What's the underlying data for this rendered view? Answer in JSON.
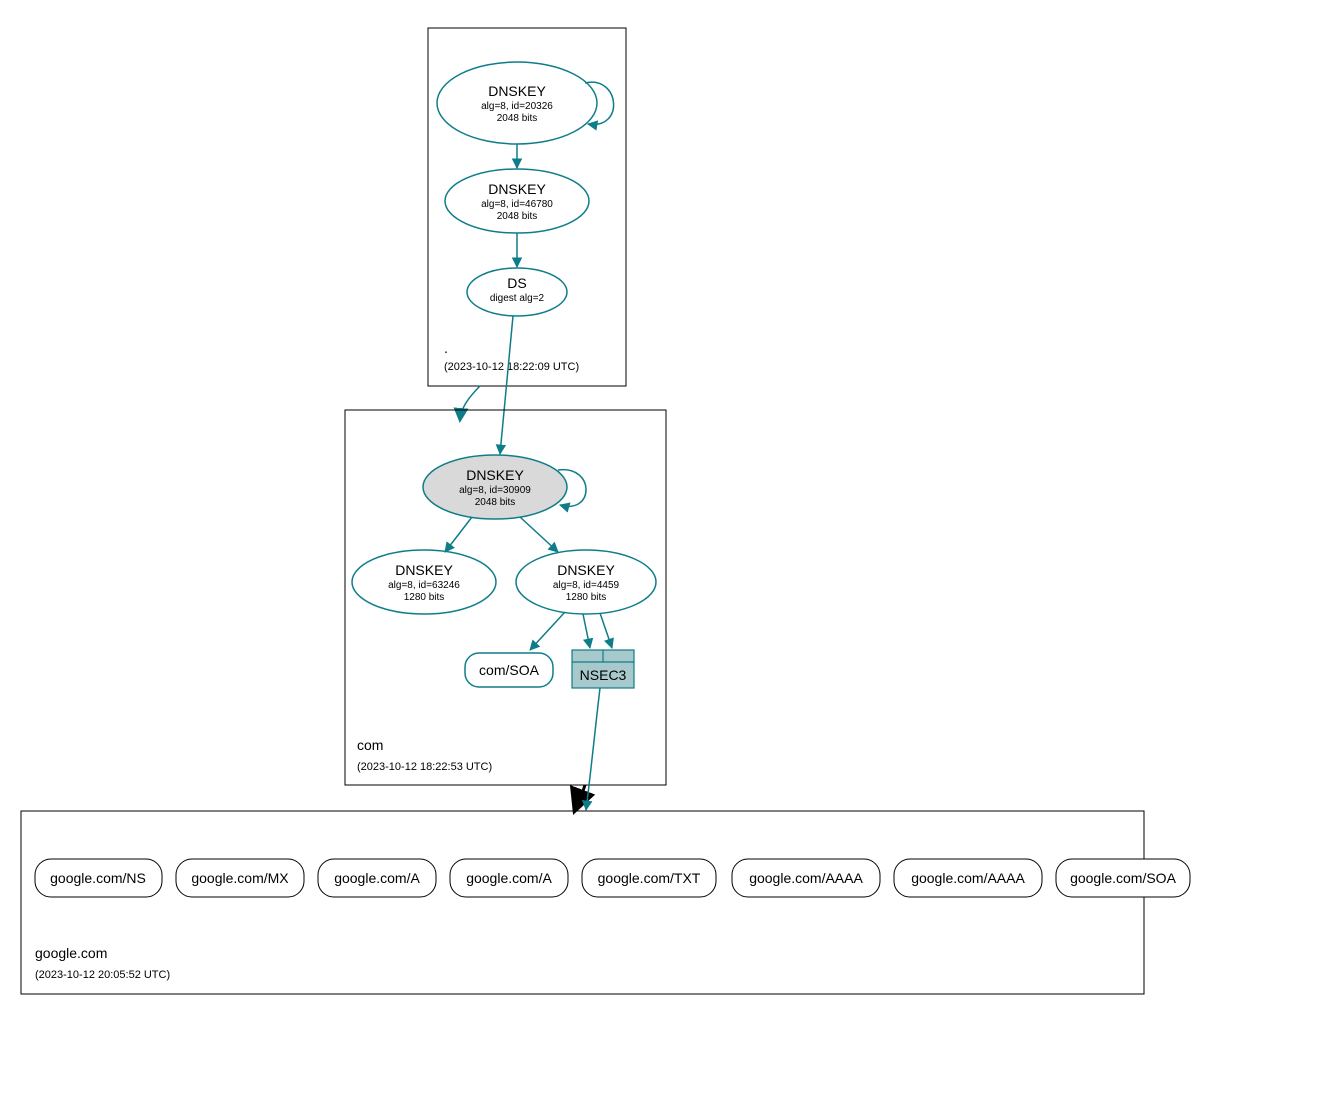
{
  "zones": {
    "root": {
      "label": ".",
      "timestamp": "(2023-10-12 18:22:09 UTC)"
    },
    "com": {
      "label": "com",
      "timestamp": "(2023-10-12 18:22:53 UTC)"
    },
    "google": {
      "label": "google.com",
      "timestamp": "(2023-10-12 20:05:52 UTC)"
    }
  },
  "nodes": {
    "root_ksk": {
      "title": "DNSKEY",
      "line1": "alg=8, id=20326",
      "line2": "2048 bits"
    },
    "root_zsk": {
      "title": "DNSKEY",
      "line1": "alg=8, id=46780",
      "line2": "2048 bits"
    },
    "root_ds": {
      "title": "DS",
      "line1": "digest alg=2"
    },
    "com_ksk": {
      "title": "DNSKEY",
      "line1": "alg=8, id=30909",
      "line2": "2048 bits"
    },
    "com_zsk1": {
      "title": "DNSKEY",
      "line1": "alg=8, id=63246",
      "line2": "1280 bits"
    },
    "com_zsk2": {
      "title": "DNSKEY",
      "line1": "alg=8, id=4459",
      "line2": "1280 bits"
    },
    "com_soa": {
      "title": "com/SOA"
    },
    "nsec3": {
      "title": "NSEC3"
    },
    "g_ns": {
      "title": "google.com/NS"
    },
    "g_mx": {
      "title": "google.com/MX"
    },
    "g_a1": {
      "title": "google.com/A"
    },
    "g_a2": {
      "title": "google.com/A"
    },
    "g_txt": {
      "title": "google.com/TXT"
    },
    "g_aaaa1": {
      "title": "google.com/AAAA"
    },
    "g_aaaa2": {
      "title": "google.com/AAAA"
    },
    "g_soa": {
      "title": "google.com/SOA"
    }
  },
  "colors": {
    "teal": "#0e7d8a",
    "grey_fill": "#d9d9d9",
    "nsec3_fill": "#a8c9cc"
  }
}
